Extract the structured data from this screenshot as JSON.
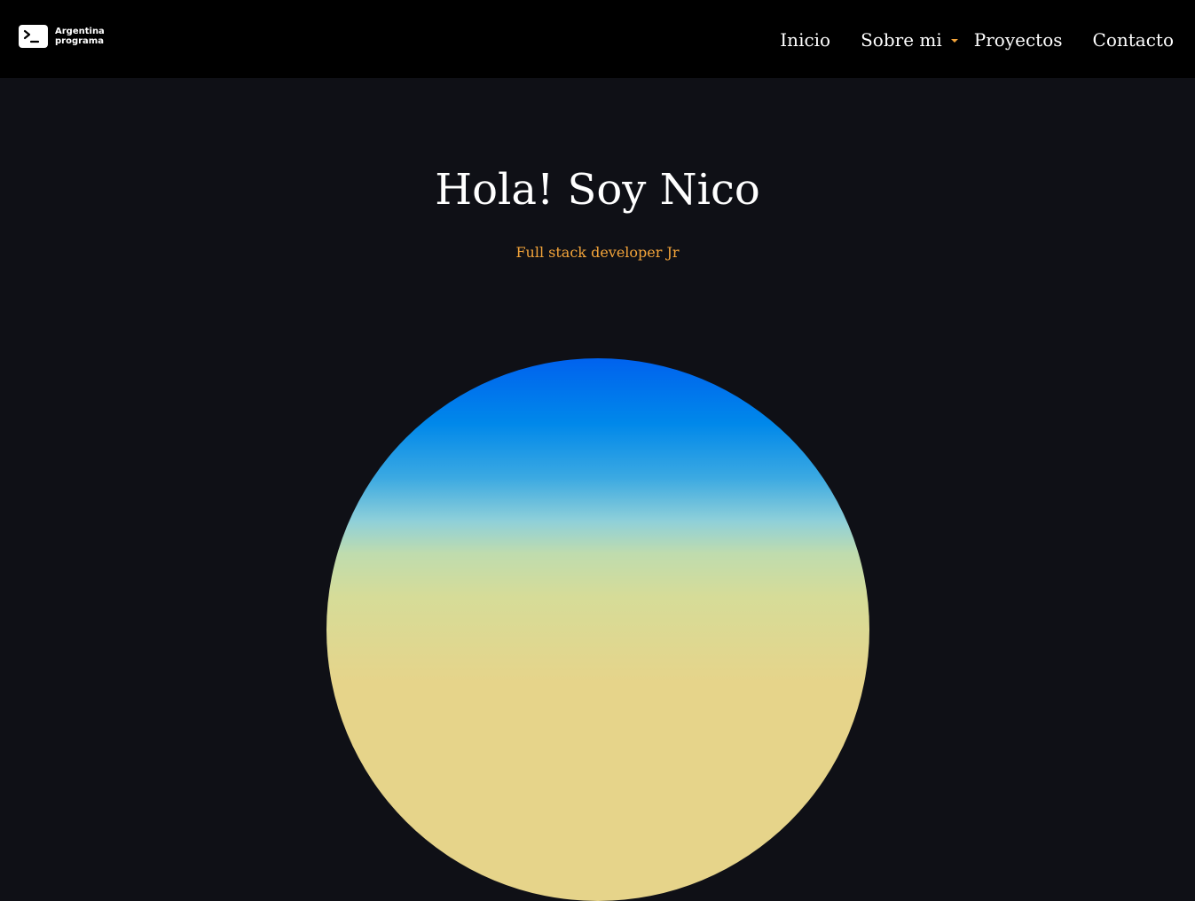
{
  "header": {
    "logo": {
      "icon": "terminal-prompt-icon",
      "line1": "Argentina",
      "line2": "programa"
    },
    "nav": {
      "home": "Inicio",
      "about": "Sobre mi",
      "projects": "Proyectos",
      "contact": "Contacto"
    }
  },
  "hero": {
    "title": "Hola! Soy Nico",
    "subtitle": "Full stack developer Jr"
  },
  "colors": {
    "accent": "#f3a43a",
    "background": "#0f1016",
    "navbar": "#000000"
  }
}
